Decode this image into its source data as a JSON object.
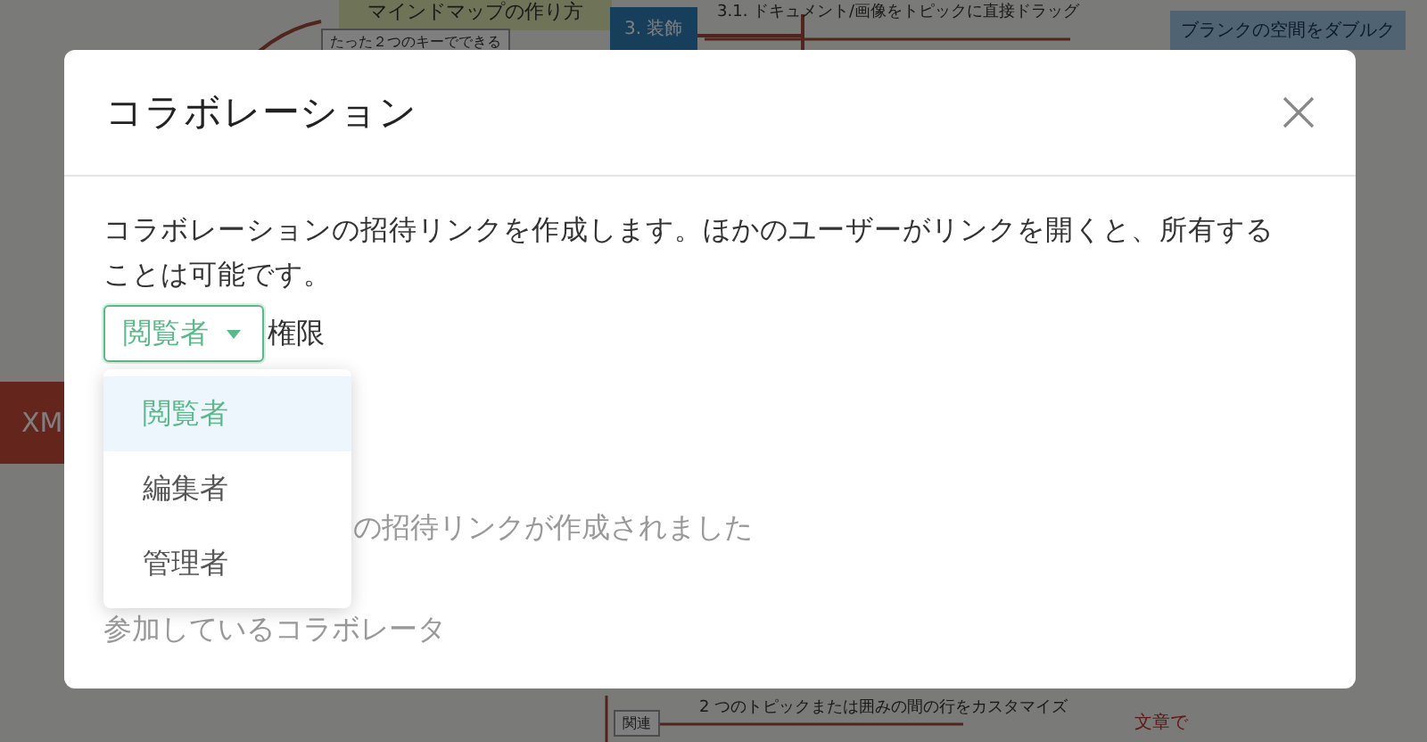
{
  "mindmap": {
    "nodes": [
      {
        "text": "マインドマップの作り方",
        "kind": "topic"
      },
      {
        "text": "たった２つのキーでできる",
        "kind": "note"
      },
      {
        "text": "3. 装飾",
        "kind": "main"
      },
      {
        "text": "3.1. ドキュメント/画像をトピックに直接ドラッグ",
        "kind": "branch"
      },
      {
        "text": "ブランクの空間をダブルク",
        "kind": "callout"
      },
      {
        "text": "XM",
        "kind": "root"
      },
      {
        "text": "2 つのトピックまたは囲みの間の行をカスタマイズ",
        "kind": "branch"
      },
      {
        "text": "関連",
        "kind": "note"
      },
      {
        "text": "文章で",
        "kind": "relation"
      }
    ]
  },
  "dialog": {
    "title": "コラボレーション",
    "description": "コラボレーションの招待リンクを作成します。ほかのユーザーがリンクを開くと、所有することは可能です。",
    "role_select": {
      "value": "閲覧者",
      "expanded": true
    },
    "permission_label": "権限",
    "menu": [
      {
        "label": "閲覧者",
        "selected": true
      },
      {
        "label": "編集者",
        "selected": false
      },
      {
        "label": "管理者",
        "selected": false
      }
    ],
    "status": "の招待リンクが作成されました",
    "collaborators_heading": "参加しているコラボレータ"
  }
}
